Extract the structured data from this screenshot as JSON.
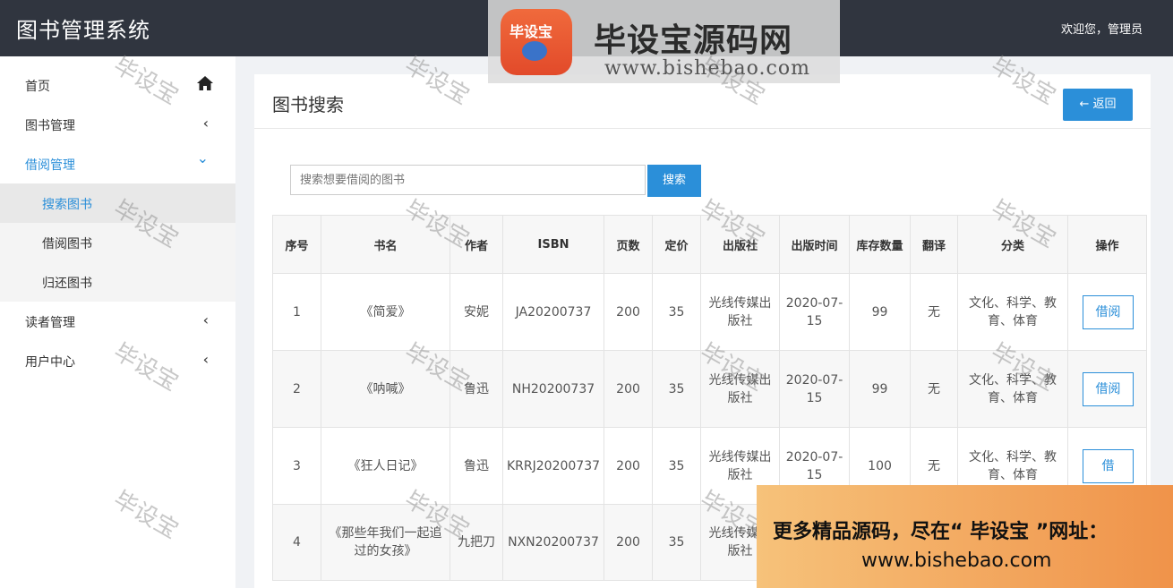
{
  "header": {
    "title": "图书管理系统",
    "welcome": "欢迎您，管理员"
  },
  "logo_watermark": {
    "badge": "毕设宝",
    "brand": "毕设宝源码网",
    "url": "www.bishebao.com"
  },
  "sidebar": {
    "items": [
      {
        "label": "首页",
        "icon": "home-icon"
      },
      {
        "label": "图书管理",
        "icon": "chevron-left-icon",
        "chevron": "‹"
      },
      {
        "label": "借阅管理",
        "icon": "chevron-down-icon",
        "chevron": "⌄"
      },
      {
        "label": "读者管理",
        "icon": "chevron-left-icon",
        "chevron": "‹"
      },
      {
        "label": "用户中心",
        "icon": "chevron-left-icon",
        "chevron": "‹"
      }
    ],
    "sub_items": [
      {
        "label": "搜索图书"
      },
      {
        "label": "借阅图书"
      },
      {
        "label": "归还图书"
      }
    ]
  },
  "main": {
    "title": "图书搜索",
    "back_label": "← 返回",
    "search": {
      "placeholder": "搜索想要借阅的图书",
      "button": "搜索"
    },
    "table": {
      "headers": [
        "序号",
        "书名",
        "作者",
        "ISBN",
        "页数",
        "定价",
        "出版社",
        "出版时间",
        "库存数量",
        "翻译",
        "分类",
        "操作"
      ],
      "rows": [
        {
          "no": "1",
          "name": "《简爱》",
          "author": "安妮",
          "isbn": "JA20200737",
          "pages": "200",
          "price": "35",
          "publisher": "光线传媒出版社",
          "date": "2020-07-15",
          "stock": "99",
          "translate": "无",
          "category": "文化、科学、教育、体育",
          "action": "借阅"
        },
        {
          "no": "2",
          "name": "《呐喊》",
          "author": "鲁迅",
          "isbn": "NH20200737",
          "pages": "200",
          "price": "35",
          "publisher": "光线传媒出版社",
          "date": "2020-07-15",
          "stock": "99",
          "translate": "无",
          "category": "文化、科学、教育、体育",
          "action": "借阅"
        },
        {
          "no": "3",
          "name": "《狂人日记》",
          "author": "鲁迅",
          "isbn": "KRRJ20200737",
          "pages": "200",
          "price": "35",
          "publisher": "光线传媒出版社",
          "date": "2020-07-15",
          "stock": "100",
          "translate": "无",
          "category": "文化、科学、教育、体育",
          "action": "借"
        },
        {
          "no": "4",
          "name": "《那些年我们一起追过的女孩》",
          "author": "九把刀",
          "isbn": "NXN20200737",
          "pages": "200",
          "price": "35",
          "publisher": "光线传媒出版社",
          "date": "",
          "stock": "",
          "translate": "",
          "category": "",
          "action": ""
        }
      ]
    }
  },
  "watermark_text": "毕设宝",
  "ad": {
    "line1": "更多精品源码，尽在“ 毕设宝 ”网址：",
    "line2": "www.bishebao.com"
  },
  "colors": {
    "topbar": "#30353f",
    "accent": "#2b8fd9"
  }
}
